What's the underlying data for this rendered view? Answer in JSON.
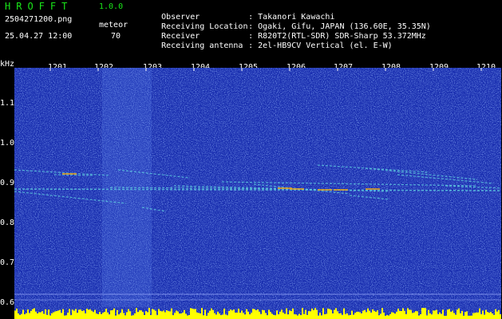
{
  "header": {
    "app_title": "HROFFT",
    "app_version": "1.0.0",
    "file_name": "2504271200.png",
    "mode_label": "meteor",
    "timestamp": "25.04.27 12:00",
    "count": "70"
  },
  "info": [
    {
      "key": "Observer",
      "sep": ":",
      "value": "Takanori Kawachi"
    },
    {
      "key": "Receiving Location",
      "sep": ":",
      "value": "Ogaki, Gifu, JAPAN (136.60E, 35.35N)"
    },
    {
      "key": "Receiver",
      "sep": ":",
      "value": "R820T2(RTL-SDR) SDR-Sharp 53.372MHz"
    },
    {
      "key": "Receiving antenna",
      "sep": ":",
      "value": "2el-HB9CV Vertical (el. E-W)"
    }
  ],
  "spectrogram": {
    "y_unit": "kHz",
    "y_ticks": [
      "1.1",
      "1.0",
      "0.9",
      "0.8",
      "0.7",
      "0.6"
    ],
    "y_range": [
      0.58,
      1.2
    ],
    "x_ticks": [
      "1201",
      "1202",
      "1203",
      "1204",
      "1205",
      "1206",
      "1207",
      "1208",
      "1209",
      "1210"
    ],
    "colors": {
      "background": "#1a2fb0",
      "noise_light": "#4a78e0",
      "trace": "#5fd0e0",
      "hot": "#e0a020",
      "baseline": "#ffff00"
    }
  }
}
